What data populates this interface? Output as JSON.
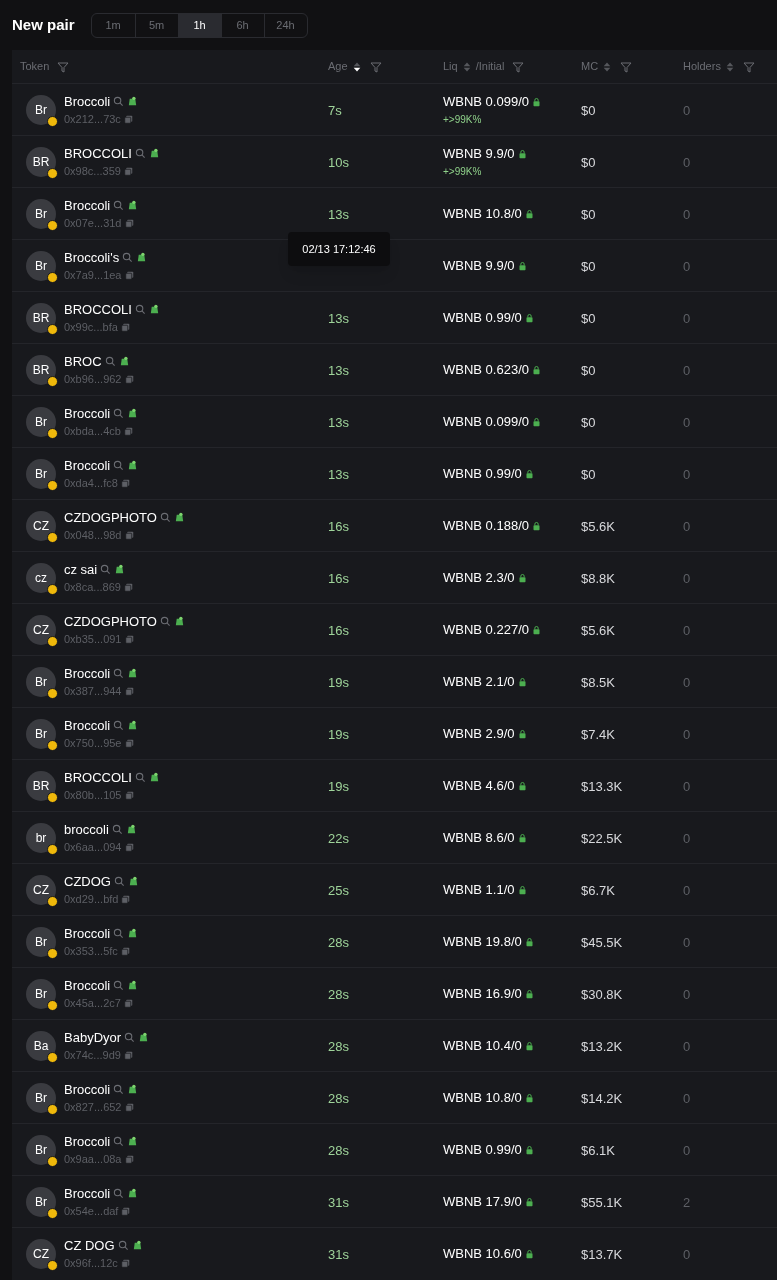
{
  "title": "New pair",
  "timeframes": [
    {
      "label": "1m",
      "selected": false
    },
    {
      "label": "5m",
      "selected": false
    },
    {
      "label": "1h",
      "selected": true
    },
    {
      "label": "6h",
      "selected": false
    },
    {
      "label": "24h",
      "selected": false
    }
  ],
  "columns": [
    {
      "label": "Token"
    },
    {
      "label": "Age",
      "sortable": true,
      "sorted": true
    },
    {
      "label": "Liq",
      "suffix": "/Initial",
      "sortable": true,
      "sorted": false
    },
    {
      "label": "MC",
      "sortable": true,
      "sorted": false
    },
    {
      "label": "Holders",
      "sortable": true,
      "sorted": false
    }
  ],
  "rows": [
    {
      "avatar": "Br",
      "name": "Broccoli",
      "address": "0x212...73c",
      "age": "7s",
      "liq": "WBNB 0.099/0",
      "change": "+>99K%",
      "mc": "$0",
      "holders": "0"
    },
    {
      "avatar": "BR",
      "name": "BROCCOLI",
      "address": "0x98c...359",
      "age": "10s",
      "liq": "WBNB 9.9/0",
      "change": "+>99K%",
      "mc": "$0",
      "holders": "0"
    },
    {
      "avatar": "Br",
      "name": "Broccoli",
      "address": "0x07e...31d",
      "age": "13s",
      "liq": "WBNB 10.8/0",
      "mc": "$0",
      "holders": "0"
    },
    {
      "avatar": "Br",
      "name": "Broccoli's",
      "address": "0x7a9...1ea",
      "liq": "WBNB 9.9/0",
      "mc": "$0",
      "holders": "0"
    },
    {
      "avatar": "BR",
      "name": "BROCCOLI",
      "address": "0x99c...bfa",
      "age": "13s",
      "liq": "WBNB 0.99/0",
      "mc": "$0",
      "holders": "0"
    },
    {
      "avatar": "BR",
      "name": "BROC",
      "address": "0xb96...962",
      "age": "13s",
      "liq": "WBNB 0.623/0",
      "mc": "$0",
      "holders": "0"
    },
    {
      "avatar": "Br",
      "name": "Broccoli",
      "address": "0xbda...4cb",
      "age": "13s",
      "liq": "WBNB 0.099/0",
      "mc": "$0",
      "holders": "0"
    },
    {
      "avatar": "Br",
      "name": "Broccoli",
      "address": "0xda4...fc8",
      "age": "13s",
      "liq": "WBNB 0.99/0",
      "mc": "$0",
      "holders": "0"
    },
    {
      "avatar": "CZ",
      "name": "CZDOGPHOTO",
      "address": "0x048...98d",
      "age": "16s",
      "liq": "WBNB 0.188/0",
      "mc": "$5.6K",
      "holders": "0"
    },
    {
      "avatar": "cz",
      "name": "cz sai",
      "address": "0x8ca...869",
      "age": "16s",
      "liq": "WBNB 2.3/0",
      "mc": "$8.8K",
      "holders": "0"
    },
    {
      "avatar": "CZ",
      "name": "CZDOGPHOTO",
      "address": "0xb35...091",
      "age": "16s",
      "liq": "WBNB 0.227/0",
      "mc": "$5.6K",
      "holders": "0"
    },
    {
      "avatar": "Br",
      "name": "Broccoli",
      "address": "0x387...944",
      "age": "19s",
      "liq": "WBNB 2.1/0",
      "mc": "$8.5K",
      "holders": "0"
    },
    {
      "avatar": "Br",
      "name": "Broccoli",
      "address": "0x750...95e",
      "age": "19s",
      "liq": "WBNB 2.9/0",
      "mc": "$7.4K",
      "holders": "0"
    },
    {
      "avatar": "BR",
      "name": "BROCCOLI",
      "address": "0x80b...105",
      "age": "19s",
      "liq": "WBNB 4.6/0",
      "mc": "$13.3K",
      "holders": "0"
    },
    {
      "avatar": "br",
      "name": "broccoli",
      "address": "0x6aa...094",
      "age": "22s",
      "liq": "WBNB 8.6/0",
      "mc": "$22.5K",
      "holders": "0"
    },
    {
      "avatar": "CZ",
      "name": "CZDOG",
      "address": "0xd29...bfd",
      "age": "25s",
      "liq": "WBNB 1.1/0",
      "mc": "$6.7K",
      "holders": "0"
    },
    {
      "avatar": "Br",
      "name": "Broccoli",
      "address": "0x353...5fc",
      "age": "28s",
      "liq": "WBNB 19.8/0",
      "mc": "$45.5K",
      "holders": "0"
    },
    {
      "avatar": "Br",
      "name": "Broccoli",
      "address": "0x45a...2c7",
      "age": "28s",
      "liq": "WBNB 16.9/0",
      "mc": "$30.8K",
      "holders": "0"
    },
    {
      "avatar": "Ba",
      "name": "BabyDyor",
      "address": "0x74c...9d9",
      "age": "28s",
      "liq": "WBNB 10.4/0",
      "mc": "$13.2K",
      "holders": "0"
    },
    {
      "avatar": "Br",
      "name": "Broccoli",
      "address": "0x827...652",
      "age": "28s",
      "liq": "WBNB 10.8/0",
      "mc": "$14.2K",
      "holders": "0"
    },
    {
      "avatar": "Br",
      "name": "Broccoli",
      "address": "0x9aa...08a",
      "age": "28s",
      "liq": "WBNB 0.99/0",
      "mc": "$6.1K",
      "holders": "0"
    },
    {
      "avatar": "Br",
      "name": "Broccoli",
      "address": "0x54e...daf",
      "age": "31s",
      "liq": "WBNB 17.9/0",
      "mc": "$55.1K",
      "holders": "2"
    },
    {
      "avatar": "CZ",
      "name": "CZ DOG",
      "address": "0x96f...12c",
      "age": "31s",
      "liq": "WBNB 10.6/0",
      "mc": "$13.7K",
      "holders": "0"
    }
  ],
  "tooltip": "02/13 17:12:46"
}
